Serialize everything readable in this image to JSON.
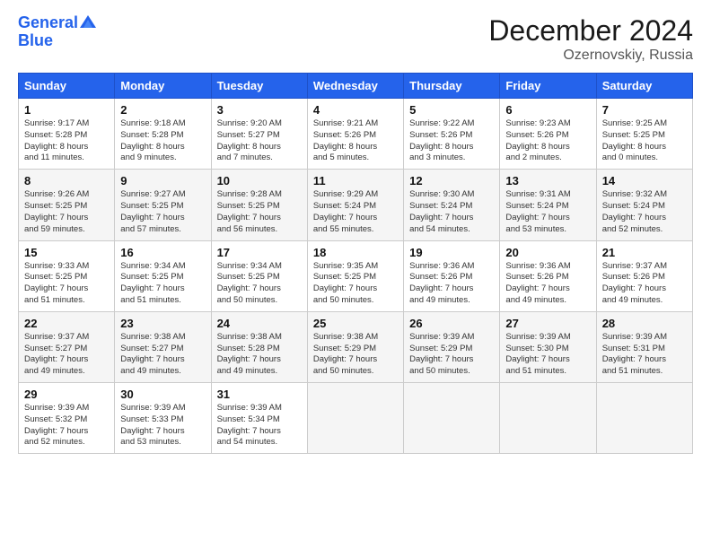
{
  "header": {
    "logo_line1": "General",
    "logo_line2": "Blue",
    "month": "December 2024",
    "location": "Ozernovskiy, Russia"
  },
  "weekdays": [
    "Sunday",
    "Monday",
    "Tuesday",
    "Wednesday",
    "Thursday",
    "Friday",
    "Saturday"
  ],
  "weeks": [
    [
      {
        "day": "1",
        "info": "Sunrise: 9:17 AM\nSunset: 5:28 PM\nDaylight: 8 hours\nand 11 minutes."
      },
      {
        "day": "2",
        "info": "Sunrise: 9:18 AM\nSunset: 5:28 PM\nDaylight: 8 hours\nand 9 minutes."
      },
      {
        "day": "3",
        "info": "Sunrise: 9:20 AM\nSunset: 5:27 PM\nDaylight: 8 hours\nand 7 minutes."
      },
      {
        "day": "4",
        "info": "Sunrise: 9:21 AM\nSunset: 5:26 PM\nDaylight: 8 hours\nand 5 minutes."
      },
      {
        "day": "5",
        "info": "Sunrise: 9:22 AM\nSunset: 5:26 PM\nDaylight: 8 hours\nand 3 minutes."
      },
      {
        "day": "6",
        "info": "Sunrise: 9:23 AM\nSunset: 5:26 PM\nDaylight: 8 hours\nand 2 minutes."
      },
      {
        "day": "7",
        "info": "Sunrise: 9:25 AM\nSunset: 5:25 PM\nDaylight: 8 hours\nand 0 minutes."
      }
    ],
    [
      {
        "day": "8",
        "info": "Sunrise: 9:26 AM\nSunset: 5:25 PM\nDaylight: 7 hours\nand 59 minutes."
      },
      {
        "day": "9",
        "info": "Sunrise: 9:27 AM\nSunset: 5:25 PM\nDaylight: 7 hours\nand 57 minutes."
      },
      {
        "day": "10",
        "info": "Sunrise: 9:28 AM\nSunset: 5:25 PM\nDaylight: 7 hours\nand 56 minutes."
      },
      {
        "day": "11",
        "info": "Sunrise: 9:29 AM\nSunset: 5:24 PM\nDaylight: 7 hours\nand 55 minutes."
      },
      {
        "day": "12",
        "info": "Sunrise: 9:30 AM\nSunset: 5:24 PM\nDaylight: 7 hours\nand 54 minutes."
      },
      {
        "day": "13",
        "info": "Sunrise: 9:31 AM\nSunset: 5:24 PM\nDaylight: 7 hours\nand 53 minutes."
      },
      {
        "day": "14",
        "info": "Sunrise: 9:32 AM\nSunset: 5:24 PM\nDaylight: 7 hours\nand 52 minutes."
      }
    ],
    [
      {
        "day": "15",
        "info": "Sunrise: 9:33 AM\nSunset: 5:25 PM\nDaylight: 7 hours\nand 51 minutes."
      },
      {
        "day": "16",
        "info": "Sunrise: 9:34 AM\nSunset: 5:25 PM\nDaylight: 7 hours\nand 51 minutes."
      },
      {
        "day": "17",
        "info": "Sunrise: 9:34 AM\nSunset: 5:25 PM\nDaylight: 7 hours\nand 50 minutes."
      },
      {
        "day": "18",
        "info": "Sunrise: 9:35 AM\nSunset: 5:25 PM\nDaylight: 7 hours\nand 50 minutes."
      },
      {
        "day": "19",
        "info": "Sunrise: 9:36 AM\nSunset: 5:26 PM\nDaylight: 7 hours\nand 49 minutes."
      },
      {
        "day": "20",
        "info": "Sunrise: 9:36 AM\nSunset: 5:26 PM\nDaylight: 7 hours\nand 49 minutes."
      },
      {
        "day": "21",
        "info": "Sunrise: 9:37 AM\nSunset: 5:26 PM\nDaylight: 7 hours\nand 49 minutes."
      }
    ],
    [
      {
        "day": "22",
        "info": "Sunrise: 9:37 AM\nSunset: 5:27 PM\nDaylight: 7 hours\nand 49 minutes."
      },
      {
        "day": "23",
        "info": "Sunrise: 9:38 AM\nSunset: 5:27 PM\nDaylight: 7 hours\nand 49 minutes."
      },
      {
        "day": "24",
        "info": "Sunrise: 9:38 AM\nSunset: 5:28 PM\nDaylight: 7 hours\nand 49 minutes."
      },
      {
        "day": "25",
        "info": "Sunrise: 9:38 AM\nSunset: 5:29 PM\nDaylight: 7 hours\nand 50 minutes."
      },
      {
        "day": "26",
        "info": "Sunrise: 9:39 AM\nSunset: 5:29 PM\nDaylight: 7 hours\nand 50 minutes."
      },
      {
        "day": "27",
        "info": "Sunrise: 9:39 AM\nSunset: 5:30 PM\nDaylight: 7 hours\nand 51 minutes."
      },
      {
        "day": "28",
        "info": "Sunrise: 9:39 AM\nSunset: 5:31 PM\nDaylight: 7 hours\nand 51 minutes."
      }
    ],
    [
      {
        "day": "29",
        "info": "Sunrise: 9:39 AM\nSunset: 5:32 PM\nDaylight: 7 hours\nand 52 minutes."
      },
      {
        "day": "30",
        "info": "Sunrise: 9:39 AM\nSunset: 5:33 PM\nDaylight: 7 hours\nand 53 minutes."
      },
      {
        "day": "31",
        "info": "Sunrise: 9:39 AM\nSunset: 5:34 PM\nDaylight: 7 hours\nand 54 minutes."
      },
      {
        "day": "",
        "info": ""
      },
      {
        "day": "",
        "info": ""
      },
      {
        "day": "",
        "info": ""
      },
      {
        "day": "",
        "info": ""
      }
    ]
  ]
}
